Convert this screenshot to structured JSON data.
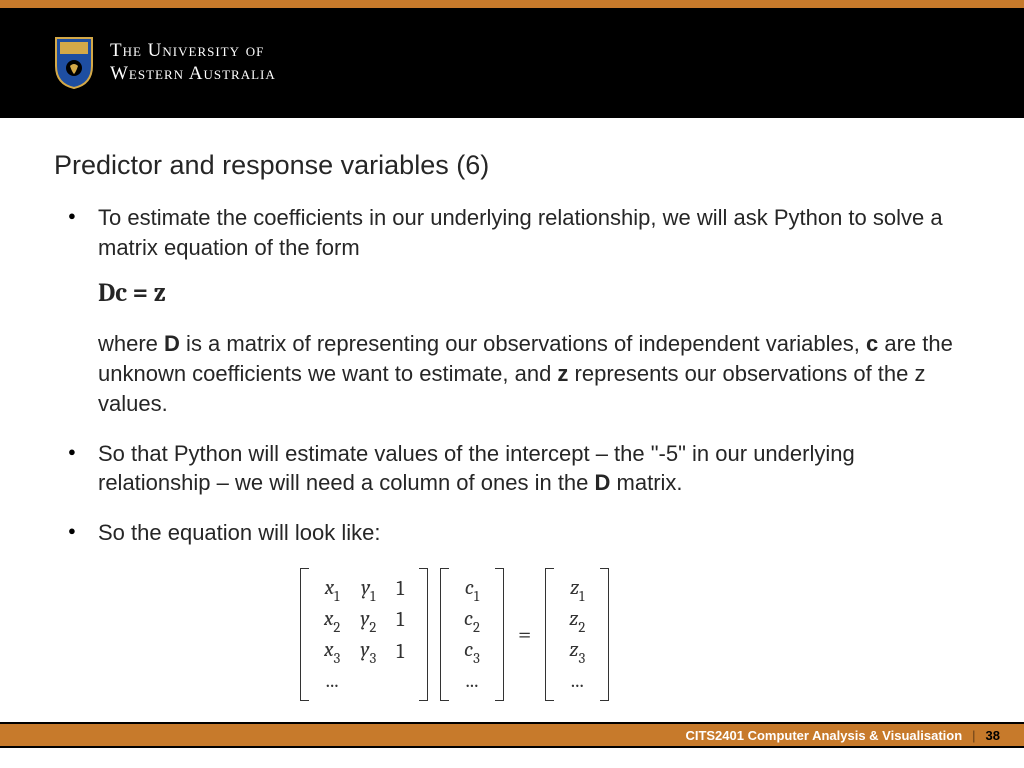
{
  "header": {
    "uni_line1": "The University of",
    "uni_line2": "Western Australia"
  },
  "slide": {
    "title": "Predictor and response variables (6)",
    "bullet1_intro": "To estimate the coefficients in our underlying relationship, we will ask Python to solve a matrix equation of the form",
    "equation_inline": "Dc = z",
    "bullet1_where_a": "where ",
    "bullet1_D": "D",
    "bullet1_where_b": " is a matrix of representing our observations of independent variables, ",
    "bullet1_c": "c",
    "bullet1_where_c": " are the unknown coefficients we want to estimate, and ",
    "bullet1_z": "z",
    "bullet1_where_d": " represents our observations of the z values.",
    "bullet2_a": "So that Python will estimate values of the intercept – the \"-5\" in our underlying relationship – we will need a column of ones in the ",
    "bullet2_D": "D",
    "bullet2_b": " matrix.",
    "bullet3": "So the equation will look like:"
  },
  "matrix": {
    "D": [
      [
        "x",
        "1",
        "y",
        "1",
        "1"
      ],
      [
        "x",
        "2",
        "y",
        "2",
        "1"
      ],
      [
        "x",
        "3",
        "y",
        "3",
        "1"
      ],
      [
        "...",
        "",
        "",
        "",
        ""
      ]
    ],
    "c": [
      [
        "c",
        "1"
      ],
      [
        "c",
        "2"
      ],
      [
        "c",
        "3"
      ],
      [
        "...",
        ""
      ]
    ],
    "z": [
      [
        "z",
        "1"
      ],
      [
        "z",
        "2"
      ],
      [
        "z",
        "3"
      ],
      [
        "...",
        ""
      ]
    ],
    "eq": "="
  },
  "footer": {
    "course": "CITS2401 Computer Analysis & Visualisation",
    "sep": "|",
    "page": "38"
  }
}
